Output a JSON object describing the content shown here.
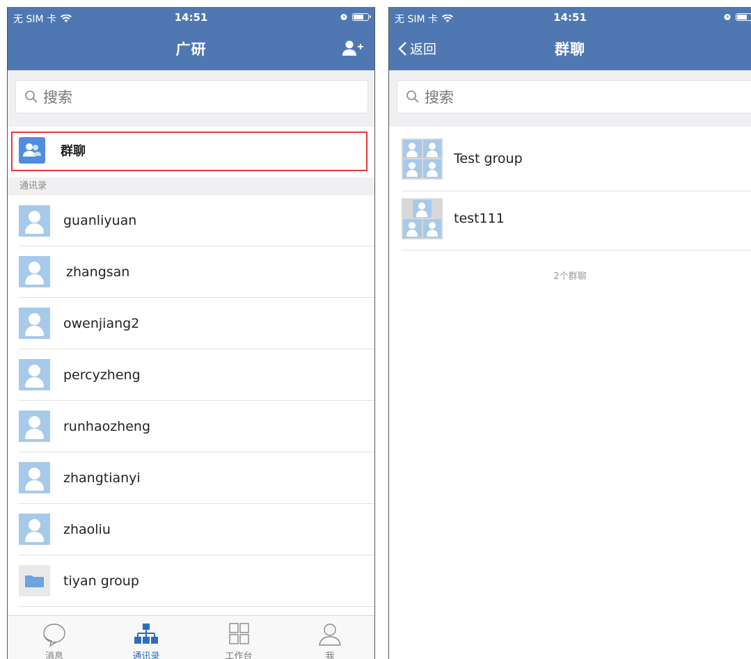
{
  "status_bar": {
    "carrier": "无 SIM 卡",
    "time": "14:51"
  },
  "left": {
    "title": "广研",
    "search_placeholder": "搜索",
    "group_chat_label": "群聊",
    "section_header": "通讯录",
    "contacts": [
      "guanliyuan",
      "zhangsan",
      "owenjiang2",
      "percyzheng",
      "runhaozheng",
      "zhangtianyi",
      "zhaoliu"
    ],
    "folder": "tiyan group",
    "tabs": [
      {
        "label": "消息",
        "icon": "chat-bubble-icon",
        "active": false
      },
      {
        "label": "通讯录",
        "icon": "org-chart-icon",
        "active": true
      },
      {
        "label": "工作台",
        "icon": "grid-icon",
        "active": false
      },
      {
        "label": "我",
        "icon": "person-outline-icon",
        "active": false
      }
    ]
  },
  "right": {
    "back_label": "返回",
    "title": "群聊",
    "search_placeholder": "搜索",
    "groups": [
      "Test group",
      "test111"
    ],
    "group_count": "2个群聊"
  },
  "colors": {
    "nav_bar": "#4f78b3",
    "avatar": "#a7c9ea",
    "accent_tab": "#2d6fb8",
    "highlight": "#e53935"
  }
}
